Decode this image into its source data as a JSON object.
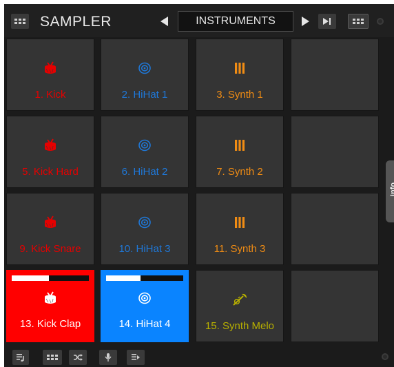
{
  "header": {
    "title": "SAMPLER",
    "bank_name": "INSTRUMENTS"
  },
  "side_tab": {
    "label": "info"
  },
  "colors": {
    "kick": "#e60000",
    "hihat": "#1f78d8",
    "synth": "#f08c14",
    "melo": "#b8b000",
    "kick_active_bg": "#ff0000",
    "hihat_active_bg": "#0a84ff"
  },
  "pads": [
    {
      "label": "1. Kick",
      "icon": "drum-icon",
      "color": "#e60000"
    },
    {
      "label": "2. HiHat 1",
      "icon": "cymbal-icon",
      "color": "#1f78d8"
    },
    {
      "label": "3. Synth 1",
      "icon": "synth-bars-icon",
      "color": "#f08c14"
    },
    {
      "label": "",
      "icon": "",
      "color": ""
    },
    {
      "label": "5. Kick Hard",
      "icon": "drum-icon",
      "color": "#e60000"
    },
    {
      "label": "6. HiHat 2",
      "icon": "cymbal-icon",
      "color": "#1f78d8"
    },
    {
      "label": "7. Synth 2",
      "icon": "synth-bars-icon",
      "color": "#f08c14"
    },
    {
      "label": "",
      "icon": "",
      "color": ""
    },
    {
      "label": "9. Kick Snare",
      "icon": "drum-icon",
      "color": "#e60000"
    },
    {
      "label": "10. HiHat 3",
      "icon": "cymbal-icon",
      "color": "#1f78d8"
    },
    {
      "label": "11. Synth 3",
      "icon": "synth-bars-icon",
      "color": "#f08c14"
    },
    {
      "label": "",
      "icon": "",
      "color": ""
    },
    {
      "label": "13. Kick Clap",
      "icon": "drum-icon",
      "color": "#ffffff",
      "active": true,
      "bg": "#ff0000",
      "progress": 0.48
    },
    {
      "label": "14. HiHat 4",
      "icon": "cymbal-icon",
      "color": "#ffffff",
      "active": true,
      "bg": "#0a84ff",
      "progress": 0.45
    },
    {
      "label": "15. Synth Melo",
      "icon": "trumpet-icon",
      "color": "#b8b000"
    },
    {
      "label": "",
      "icon": "",
      "color": ""
    }
  ],
  "toolbar": {
    "icons": [
      "playlist-add-icon",
      "grid-icon",
      "shuffle-icon",
      "microphone-icon",
      "record-icon"
    ]
  }
}
